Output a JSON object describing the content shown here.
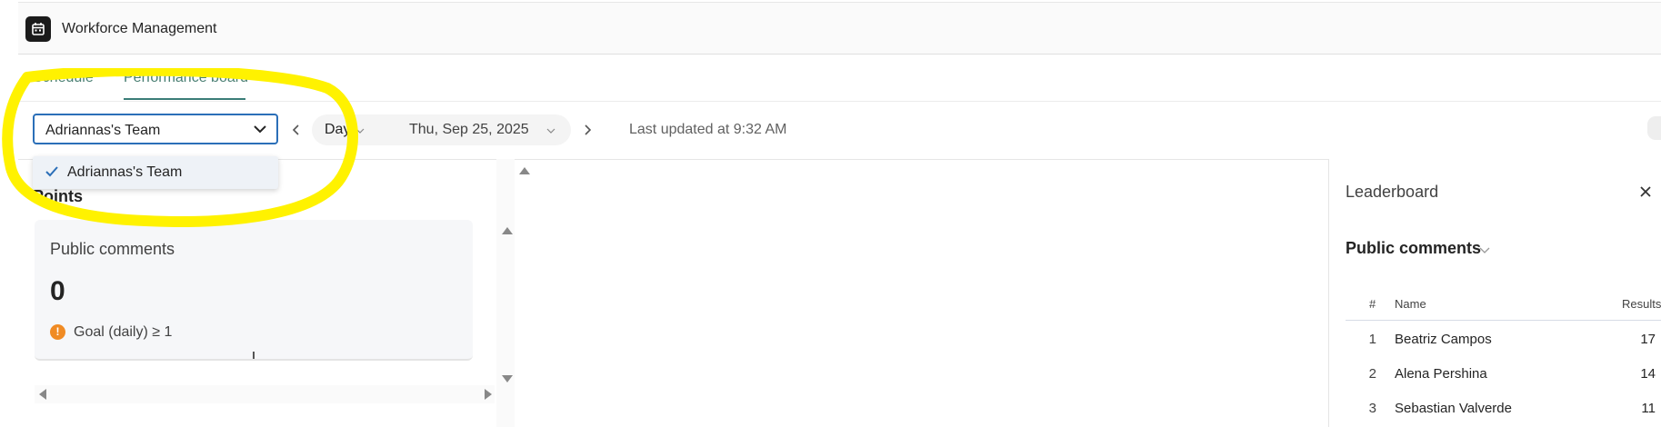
{
  "app": {
    "title": "Workforce Management",
    "icon": "calendar-icon"
  },
  "tabs": [
    {
      "label": "Schedule",
      "active": false
    },
    {
      "label": "Performance board",
      "active": true
    }
  ],
  "toolbar": {
    "team_select_value": "Adriannas's Team",
    "period_label": "Day",
    "date_label": "Thu, Sep 25, 2025",
    "last_updated": "Last updated at 9:32 AM"
  },
  "dropdown": {
    "options": [
      {
        "label": "Adriannas's Team",
        "selected": true
      }
    ]
  },
  "points": {
    "title": "Points",
    "card": {
      "title": "Public comments",
      "value": "0",
      "goal": "Goal (daily) ≥ 1",
      "goal_icon": "warning-icon"
    }
  },
  "leaderboard": {
    "title": "Leaderboard",
    "metric": "Public comments",
    "columns": {
      "rank": "#",
      "name": "Name",
      "results": "Results"
    },
    "rows": [
      {
        "rank": "1",
        "name": "Beatriz Campos",
        "result": "17"
      },
      {
        "rank": "2",
        "name": "Alena Pershina",
        "result": "14"
      },
      {
        "rank": "3",
        "name": "Sebastian Valverde",
        "result": "11"
      }
    ]
  },
  "colors": {
    "accent": "#2b6fb8",
    "tab_active": "#3a7d78",
    "warning": "#f08b24",
    "highlight_annotation": "#fff200"
  }
}
